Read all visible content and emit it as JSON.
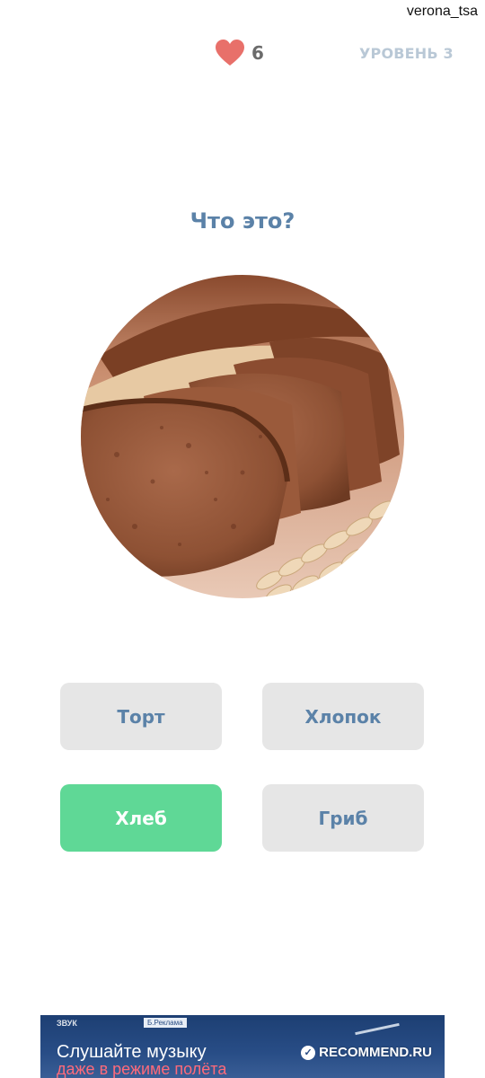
{
  "watermark": {
    "username": "verona_tsa",
    "site": "RECOMMEND.RU"
  },
  "header": {
    "lives_icon": "heart-icon",
    "lives_count": "6",
    "level_label": "УРОВЕНЬ 3"
  },
  "question": {
    "text": "Что это?",
    "image": "rye-bread-slices-photo"
  },
  "answers": [
    {
      "label": "Торт",
      "state": "neutral"
    },
    {
      "label": "Хлопок",
      "state": "neutral"
    },
    {
      "label": "Хлеб",
      "state": "correct"
    },
    {
      "label": "Гриб",
      "state": "neutral"
    }
  ],
  "ad": {
    "brand": "ЗВУК",
    "tag": "Б.Реклама",
    "line1": "Слушайте музыку",
    "line2": "даже в режиме полёта"
  },
  "colors": {
    "accent_blue": "#5b82a8",
    "correct_green": "#5fd896",
    "neutral_button": "#e6e6e6",
    "heart": "#e8706a",
    "level_text": "#b9c8d6"
  }
}
